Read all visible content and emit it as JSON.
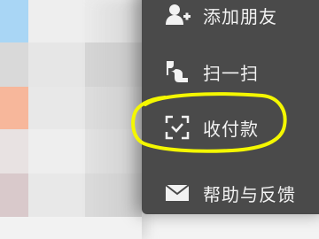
{
  "menu": {
    "items": [
      {
        "label": "添加朋友",
        "icon": "add-friend-icon"
      },
      {
        "label": "扫一扫",
        "icon": "scan-icon"
      },
      {
        "label": "收付款",
        "icon": "payment-scan-icon"
      },
      {
        "label": "帮助与反馈",
        "icon": "envelope-icon"
      }
    ]
  },
  "colors": {
    "menu_background": "#4a4a4a",
    "menu_text": "#f2f2f2",
    "highlight_yellow": "#f4f700"
  }
}
